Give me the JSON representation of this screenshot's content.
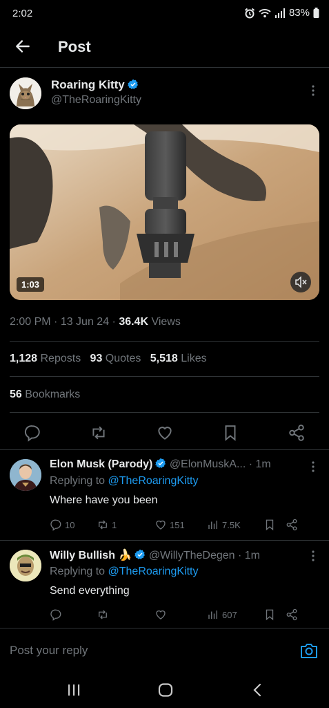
{
  "status_bar": {
    "time": "2:02",
    "battery": "83%"
  },
  "header": {
    "title": "Post"
  },
  "post": {
    "author_name": "Roaring Kitty",
    "author_handle": "@TheRoaringKitty",
    "video_duration": "1:03",
    "time": "2:00 PM",
    "date": "13 Jun 24",
    "views_count": "36.4K",
    "views_label": "Views",
    "reposts_count": "1,128",
    "reposts_label": "Reposts",
    "quotes_count": "93",
    "quotes_label": "Quotes",
    "likes_count": "5,518",
    "likes_label": "Likes",
    "bookmarks_count": "56",
    "bookmarks_label": "Bookmarks"
  },
  "replies": [
    {
      "name": "Elon Musk (Parody)",
      "handle": "@ElonMuskA...",
      "age": "1m",
      "replying_to_label": "Replying to",
      "replying_to": "@TheRoaringKitty",
      "text": "Where have you been",
      "replies": "10",
      "reposts": "1",
      "likes": "151",
      "views": "7.5K"
    },
    {
      "name": "Willy Bullish",
      "emoji": "🍌",
      "handle": "@WillyTheDegen",
      "age": "1m",
      "replying_to_label": "Replying to",
      "replying_to": "@TheRoaringKitty",
      "text": "Send everything",
      "replies": "",
      "reposts": "",
      "likes": "",
      "views": "607"
    }
  ],
  "reply_bar": {
    "placeholder": "Post your reply"
  },
  "colors": {
    "background": "#000000",
    "text": "#e7e9ea",
    "muted": "#71767b",
    "accent": "#1d9bf0",
    "divider": "#2f3336"
  },
  "icons": [
    "alarm-icon",
    "wifi-icon",
    "signal-icon",
    "battery-icon",
    "back-arrow-icon",
    "verified-icon",
    "more-icon",
    "mute-icon",
    "reply-icon",
    "repost-icon",
    "like-icon",
    "bookmark-icon",
    "share-icon",
    "views-icon",
    "camera-icon",
    "recents-icon",
    "home-icon",
    "nav-back-icon"
  ]
}
